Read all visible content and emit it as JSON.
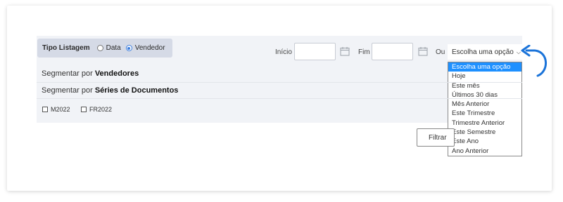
{
  "listing": {
    "title": "Tipo Listagem",
    "options": [
      "Data",
      "Vendedor"
    ],
    "selected": "Vendedor"
  },
  "dates": {
    "start_label": "Início",
    "end_label": "Fim",
    "or_label": "Ou"
  },
  "period_select": {
    "value": "Escolha uma opção",
    "options": [
      "Escolha uma opção",
      "Hoje",
      "Este mês",
      "Últimos 30 dias",
      "Mês Anterior",
      "Este Trimestre",
      "Trimestre Anterior",
      "Este Semestre",
      "Este Ano",
      "Ano Anterior"
    ]
  },
  "segments": {
    "vendors_prefix": "Segmentar por ",
    "vendors_bold": "Vendedores",
    "series_prefix": "Segmentar por ",
    "series_bold": "Séries de Documentos"
  },
  "series_checkboxes": [
    "M2022",
    "FR2022"
  ],
  "filter_button": "Filtrar",
  "colors": {
    "accent": "#1e90ff",
    "arrow": "#1a73d9",
    "panel": "#f1f3f7",
    "listing_box": "#d5dae6"
  }
}
